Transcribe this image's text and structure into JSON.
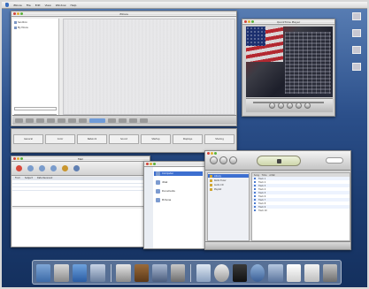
{
  "menubar": {
    "items": [
      "iMovie",
      "File",
      "Edit",
      "View",
      "Window",
      "Help"
    ]
  },
  "main_window": {
    "title": "iMovie",
    "sidebar_items": [
      "Sandbox",
      "My Movie"
    ],
    "toolbar_buttons": 12
  },
  "strip": {
    "cells": [
      "General",
      "Color",
      "Network",
      "Sound",
      "Startup",
      "Displays",
      "Sharing"
    ]
  },
  "video_player": {
    "title": "QuickTime Player"
  },
  "mail": {
    "title": "Mail",
    "toolbar": [
      "Delete",
      "Reply",
      "Reply All",
      "Forward",
      "Compose",
      "Mailbox"
    ],
    "columns": [
      "From",
      "Subject",
      "Date Received"
    ]
  },
  "finder": {
    "items": [
      "Computer",
      "iDisk",
      "Documents",
      "Pictures"
    ]
  },
  "itunes": {
    "title": "iTunes",
    "source": [
      "Library",
      "Radio Tuner",
      "Audio CD",
      "Playlist"
    ],
    "tracks": [
      "Track 1",
      "Track 2",
      "Track 3",
      "Track 4",
      "Track 5",
      "Track 6",
      "Track 7",
      "Track 8",
      "Track 9",
      "Track 10"
    ],
    "columns": [
      "Song",
      "Time",
      "Artist"
    ]
  },
  "colors": {
    "desktop": "#1c3c70",
    "selection": "#3d6fd0"
  },
  "dock": {
    "items": [
      "finder-icon",
      "mail-icon",
      "ie-icon",
      "itunes-icon",
      "imovie-icon",
      "iphoto-icon",
      "quicktime-icon",
      "system-prefs-icon",
      "sherlock-icon",
      "clock-icon",
      "terminal-icon",
      "globe-icon",
      "appstore-icon",
      "doc-icon",
      "folder-icon",
      "trash-icon"
    ]
  }
}
